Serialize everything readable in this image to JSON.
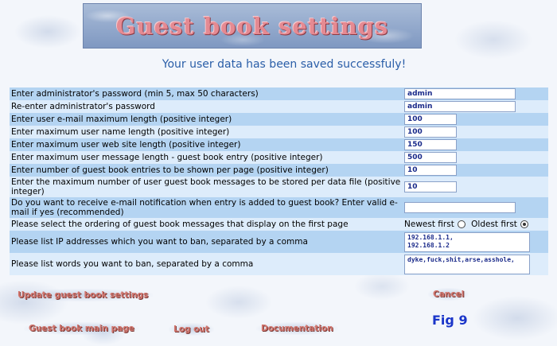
{
  "header": {
    "title": "Guest book settings"
  },
  "status": {
    "message": "Your user data has been saved successfuly!"
  },
  "form": {
    "rows": [
      {
        "label": "Enter administrator's password (min 5, max 50 characters)",
        "value": "admin"
      },
      {
        "label": "Re-enter administrator's password",
        "value": "admin"
      },
      {
        "label": "Enter user e-mail maximum length (positive integer)",
        "value": "100"
      },
      {
        "label": "Enter maximum user name length (positive integer)",
        "value": "100"
      },
      {
        "label": "Enter maximum user web site length (positive integer)",
        "value": "150"
      },
      {
        "label": "Enter maximum user message length - guest book entry (positive integer)",
        "value": "500"
      },
      {
        "label": "Enter number of guest book entries to be shown per page (positive integer)",
        "value": "10"
      },
      {
        "label": "Enter the maximum number of user guest book messages to be stored per data file (positive integer)",
        "value": "10"
      },
      {
        "label": "Do you want to receive e-mail notification when entry is added to guest book? Enter valid e-mail if yes (recommended)",
        "value": ""
      },
      {
        "label": "Please select the ordering of guest book messages that display on the first page",
        "option1": "Newest first",
        "option2": "Oldest first",
        "selected": "Oldest first"
      },
      {
        "label": "Please list IP addresses which you want to ban, separated by a comma",
        "value": "192.168.1.1,\n192.168.1.2"
      },
      {
        "label": "Please list words you want to ban, separated by a comma",
        "value": "dyke,fuck,shit,arse,asshole,"
      }
    ]
  },
  "buttons": {
    "update": "Update guest book settings",
    "cancel": "Cancel",
    "main_page": "Guest book main page",
    "logout": "Log out",
    "documentation": "Documentation"
  },
  "figure_label": "Fig 9"
}
